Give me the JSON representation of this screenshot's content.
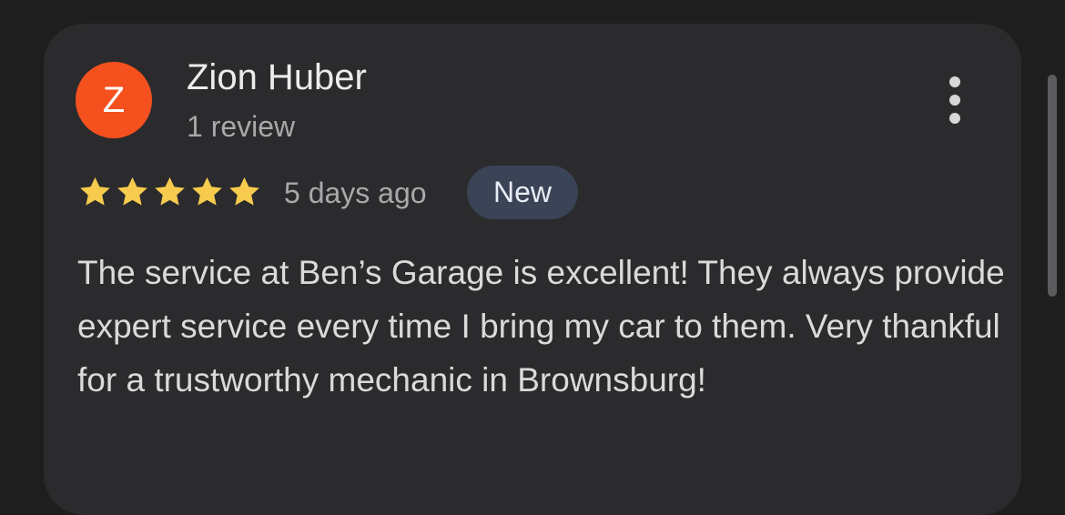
{
  "review": {
    "avatar_letter": "Z",
    "avatar_color": "#f4511e",
    "author_name": "Zion Huber",
    "review_count": "1 review",
    "rating": 5,
    "rating_max": 5,
    "star_color": "#f7cb4d",
    "time_ago": "5 days ago",
    "badge_label": "New",
    "text": "The service at Ben’s Garage is excellent! They always provide expert service every time I bring my car to them. Very thankful for a trustworthy mechanic in Brownsburg!"
  },
  "icons": {
    "menu": "more-vert-icon",
    "star": "star-icon"
  }
}
